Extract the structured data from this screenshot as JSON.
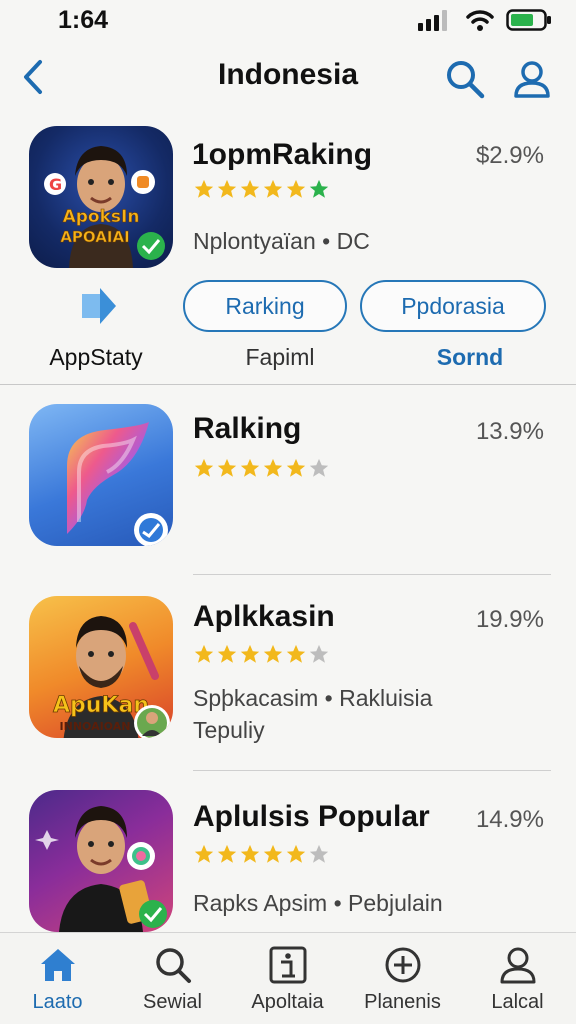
{
  "status": {
    "time": "1:64"
  },
  "nav": {
    "title": "Indonesia"
  },
  "featured": {
    "title": "1opmRaking",
    "percent": "$2.9%",
    "rating_stars": 5,
    "subtitle": "Nplontyaïan • DC",
    "icon_text_line1": "ApoksIn",
    "icon_text_line2": "APOAIAI",
    "actions": {
      "appstaty_label": "AppStaty",
      "rarking_label": "Rarking",
      "fapiml_label": "Fapiml",
      "ppdorasia_label": "Ppdorasia",
      "sornd_label": "Sornd"
    }
  },
  "apps": [
    {
      "title": "Ralking",
      "percent": "13.9%",
      "rating_stars": 4,
      "subtitle_line1": "",
      "subtitle_line2": ""
    },
    {
      "title": "Aplkkasin",
      "percent": "19.9%",
      "rating_stars": 4,
      "subtitle_line1": "Spþkacasim • Rakluisia",
      "subtitle_line2": "Tepuliy",
      "icon_text_line1": "ApuKan",
      "icon_text_line2": "INNOAIOAN"
    },
    {
      "title": "Aplulsis Popular",
      "percent": "14.9%",
      "rating_stars": 4,
      "subtitle_line1": "Rapks Apsim • Pebjulain",
      "subtitle_line2": ""
    }
  ],
  "tabs": [
    {
      "label": "Laato",
      "icon": "home-icon",
      "active": true
    },
    {
      "label": "Sewial",
      "icon": "search-icon",
      "active": false
    },
    {
      "label": "Apoltaia",
      "icon": "info-icon",
      "active": false
    },
    {
      "label": "Planenis",
      "icon": "plus-circle-icon",
      "active": false
    },
    {
      "label": "Lalcal",
      "icon": "person-icon",
      "active": false
    }
  ],
  "colors": {
    "accent": "#1d6bb0",
    "star_gold": "#f2b81c",
    "star_green": "#2bb24c",
    "star_gray": "#bdbdbd",
    "background": "#f6f6f4"
  }
}
